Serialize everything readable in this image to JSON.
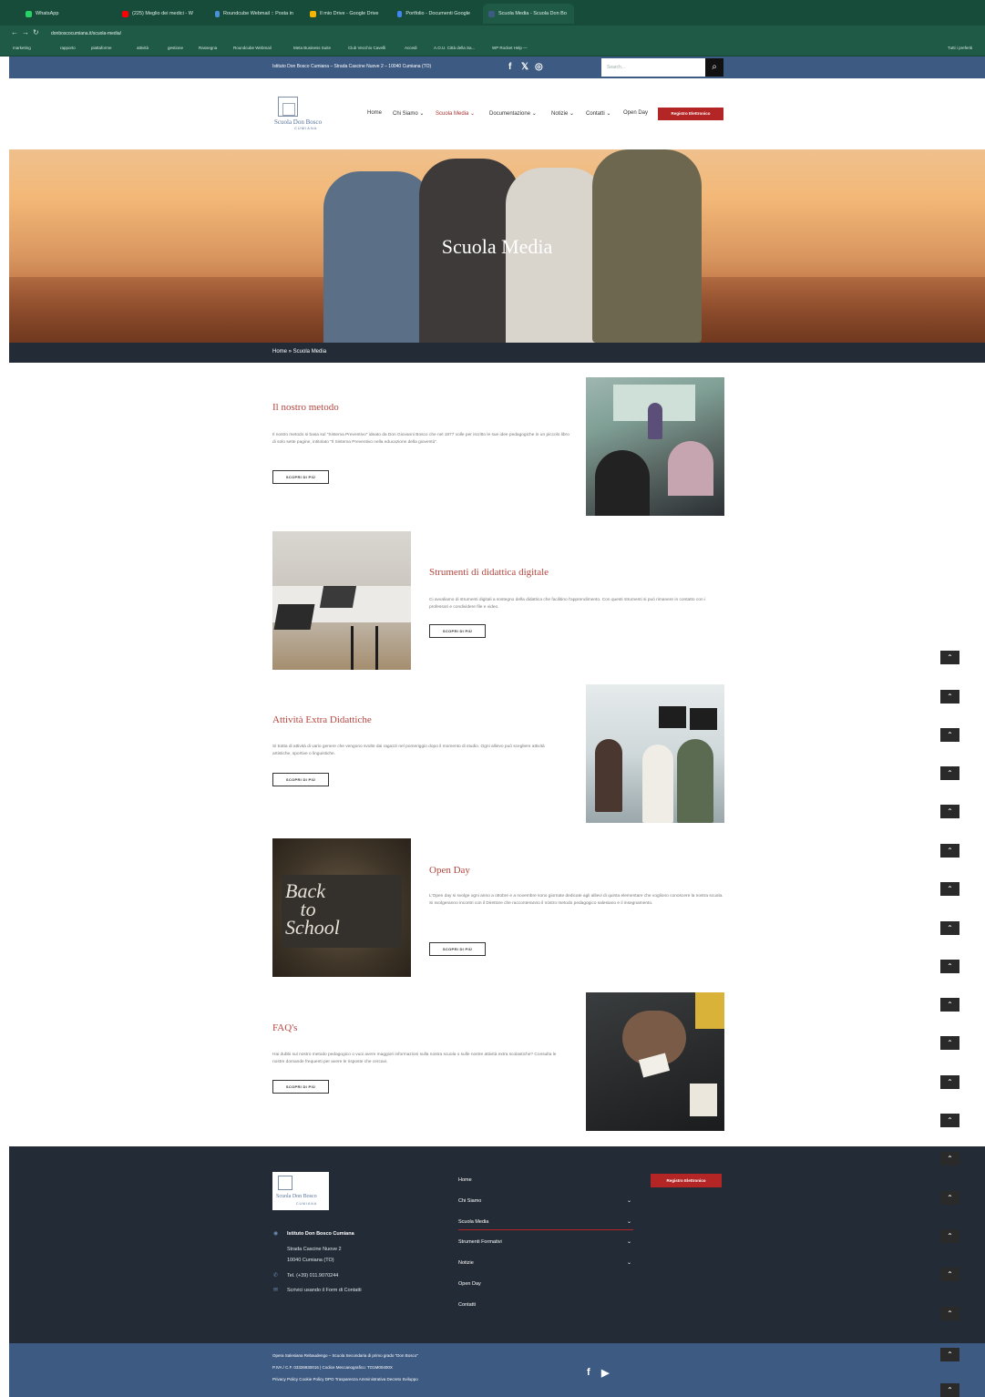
{
  "browser": {
    "tabs": [
      {
        "label": "WhatsApp",
        "color": "#25d366"
      },
      {
        "label": "(225) Meglio dei medici - W",
        "color": "#ff0000"
      },
      {
        "label": "Roundcube Webmail :: Posta in",
        "color": "#4a90d9"
      },
      {
        "label": "Il mio Drive - Google Drive",
        "color": "#f4b400"
      },
      {
        "label": "Portfolio - Documenti Google",
        "color": "#4285f4"
      },
      {
        "label": "Scuola Media - Scuola Don Bo",
        "color": "#3d5a82"
      }
    ],
    "url": "donboscocumiana.it/scuola-media/",
    "bookmarks": [
      "marketing",
      "rapporto",
      "piattaforme",
      "attività",
      "gestione",
      "Rassegna",
      "Roundcube Webmail",
      "Meta Business Suite",
      "Club Vecchio Cavelli",
      "Accedi",
      "A.O.U. Città della Sa...",
      "WP Rocket Help —",
      "Tutti i preferiti"
    ]
  },
  "topbar": {
    "address": "Istituto Don Bosco Cumiana – Strada Cascine Nuove 2 – 10040 Cumiana (TO)",
    "social": [
      "f",
      "𝕏",
      "◎"
    ],
    "search_placeholder": "Search...",
    "search_icon": "⌕"
  },
  "header": {
    "logo_line1": "Scuola Don Bosco",
    "logo_line2": "CUMIANA",
    "menu": [
      "Home",
      "Chi Siamo ⌄",
      "Scuola Media ⌄",
      "Documentazione ⌄",
      "Notizie ⌄",
      "Contatti ⌄",
      "Open Day"
    ],
    "register_button": "Registro Elettronico"
  },
  "hero": {
    "title": "Scuola Media"
  },
  "breadcrumb": "Home » Scuola Media",
  "sections": [
    {
      "title": "Il nostro metodo",
      "text": "Il nostro metodo si basa sul \"Sistema Preventivo\" ideato da Don Giovanni Bosco che nel 1877 volle per iscritto le sue idee pedagogiche in un piccolo libro di solo sette pagine, intitolato \"Il Sistema Preventivo nella educazione della gioventù\".",
      "button": "SCOPRI DI PIÙ"
    },
    {
      "title": "Strumenti di didattica digitale",
      "text": "Ci avvaliamo di strumenti digitali a sostegno della didattica che facilitino l'apprendimento. Con questi strumenti si può rimanere in contatto con i professori e condividere file e video.",
      "button": "SCOPRI DI PIÙ"
    },
    {
      "title": "Attività Extra Didattiche",
      "text": "Si tratta di attività di vario genere che vengono svolte dai ragazzi nel pomeriggio dopo il momento di studio. Ogni allievo può scegliere attività artistiche, sportive o linguistiche.",
      "button": "SCOPRI DI PIÙ"
    },
    {
      "title": "Open Day",
      "text": "L'Open day si svolge ogni anno a ottobre e a novembre sono giornate dedicate agli allievi di quinta elementare che vogliono conoscere la nostra scuola. Si svolgeranno incontri con il Direttore che racconteranno il nostro metodo pedagogico salesiano e il insegnamento.",
      "button": "SCOPRI DI PIÙ"
    },
    {
      "title": "FAQ's",
      "text": "Hai dubbi sul nostro metodo pedagogico o vuoi avere maggiori informazioni sulla nostra scuola o sulle nostre attività extra scolastiche? Consulta le nostre domande frequenti per avere le risposte che cercavi.",
      "button": "SCOPRI DI PIÙ"
    }
  ],
  "scroll_top_icon": "⌃",
  "footer": {
    "logo_line1": "Scuola Don Bosco",
    "logo_line2": "CUMIANA",
    "institute": "Istituto Don Bosco Cumiana",
    "address1": "Strada Cascine Nuove 2",
    "address2": "10040 Cumiana (TO)",
    "phone": "Tel. (+39) 011.9070244",
    "contact": "Scrivici usando il Form di Contatti",
    "menu": [
      "Home",
      "Chi Siamo",
      "Scuola Media",
      "Strumenti Formativi",
      "Notizie",
      "Open Day",
      "Contatti"
    ],
    "register_button": "Registro Elettronico"
  },
  "bottom": {
    "line1": "Opera Salesiana Rebaudengo – Scuola Secondaria di primo grado \"Don Bosco\"",
    "line2": "P.IVA / C.F. 03326930016 | Codice Meccanografico: TO1M00400X",
    "line3": "Privacy Policy   Cookie Policy   DPO   Trasparenza Amministrativa   Decreto Sviluppo",
    "social": [
      "f",
      "▶"
    ]
  }
}
